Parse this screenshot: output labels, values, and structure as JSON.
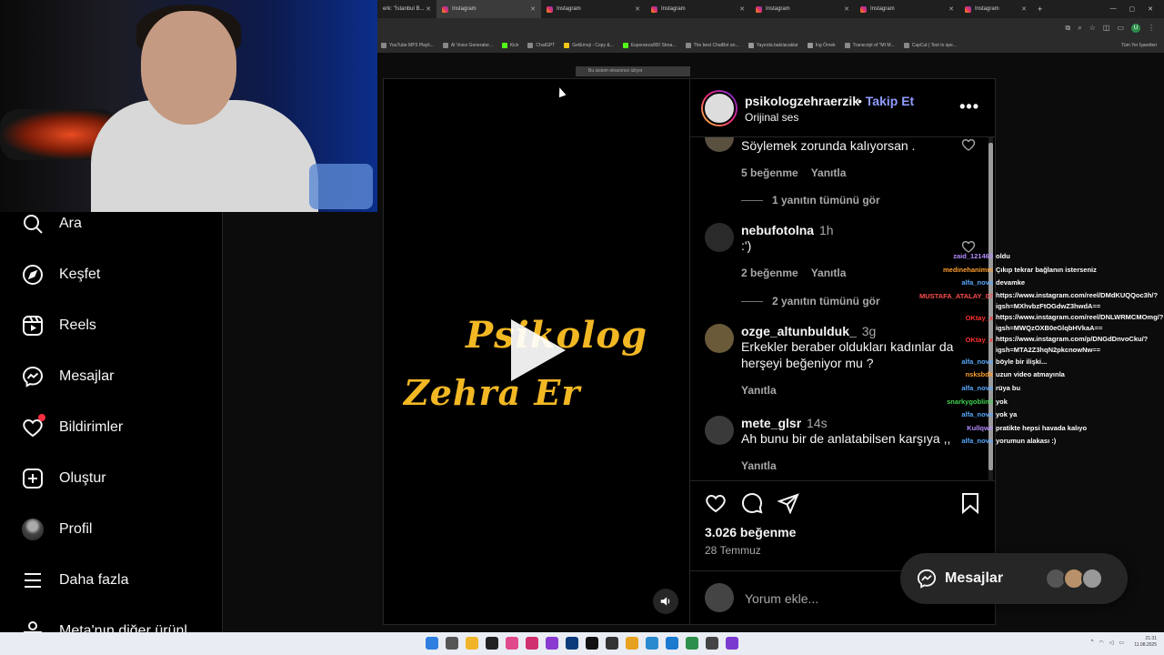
{
  "browser": {
    "tabs": [
      {
        "label": "erk: \"İstanbul B..."
      },
      {
        "label": "Instagram",
        "active": true
      },
      {
        "label": "Instagram"
      },
      {
        "label": "Instagram"
      },
      {
        "label": "Instagram"
      },
      {
        "label": "Instagram"
      },
      {
        "label": "Instagram"
      }
    ],
    "bookmarks": [
      "YouTube MP3 Playli...",
      "AI Voice Generator...",
      "Kick",
      "ChatGPT",
      "GetEmoji - Copy &...",
      "Esperanza000 Strea...",
      "The best ChatBot an...",
      "Yayında bakılacaklar",
      "İng Örnek",
      "Transcript of \"MI M...",
      "CapCut | Text to spe..."
    ],
    "bookmarks_all": "Tüm Yer İşaretleri",
    "profile_initial": "U",
    "banner": "Bu sistem ekranınızı izliyor"
  },
  "sidebar": {
    "items": [
      {
        "label": "Ara",
        "icon": "search-icon"
      },
      {
        "label": "Keşfet",
        "icon": "compass-icon"
      },
      {
        "label": "Reels",
        "icon": "reels-icon"
      },
      {
        "label": "Mesajlar",
        "icon": "messenger-icon"
      },
      {
        "label": "Bildirimler",
        "icon": "heart-icon"
      },
      {
        "label": "Oluştur",
        "icon": "plus-square-icon"
      },
      {
        "label": "Profil",
        "icon": "avatar"
      },
      {
        "label": "Daha fazla",
        "icon": "menu-icon"
      },
      {
        "label": "Meta'nın diğer ürünl",
        "icon": "meta-apps-icon"
      }
    ]
  },
  "video": {
    "title_line1": "Psikolog",
    "title_line2": "Zehra Er"
  },
  "post": {
    "username": "psikologzehraerzik",
    "follow": "Takip Et",
    "separator": "•",
    "audio": "Orijinal ses",
    "likes": "3.026 beğenme",
    "date": "28 Temmuz",
    "comment_placeholder": "Yorum ekle...",
    "comments": [
      {
        "user": "",
        "time": "",
        "text": "Söylemek zorunda kalıyorsan .",
        "likes": "5 beğenme",
        "reply": "Yanıtla",
        "replies": "1 yanıtın tümünü gör"
      },
      {
        "user": "nebufotolna",
        "time": "1h",
        "text": ":')",
        "likes": "2 beğenme",
        "reply": "Yanıtla",
        "replies": "2 yanıtın tümünü gör"
      },
      {
        "user": "ozge_altunbulduk_",
        "time": "3g",
        "text": "Erkekler beraber oldukları kadınlar da herşeyi beğeniyor mu ?",
        "likes": "",
        "reply": "Yanıtla",
        "replies": ""
      },
      {
        "user": "mete_glsr",
        "time": "14s",
        "text": "Ah bunu bir de anlatabilsen karşıya ,,",
        "likes": "",
        "reply": "Yanıtla",
        "replies": ""
      }
    ]
  },
  "chat": [
    {
      "name": "zaid_121463",
      "color": "#b48cff",
      "text": "oldu"
    },
    {
      "name": "medinehanimm",
      "color": "#ff9f2e",
      "text": "Çıkıp tekrar bağlanın isterseniz"
    },
    {
      "name": "alfa_nova",
      "color": "#5aa8ff",
      "text": "devamke"
    },
    {
      "name": "MUSTAFA_ATALAY_07",
      "color": "#ff4d4d",
      "text": "https://www.instagram.com/reel/DMdKUQQoc3h/?igsh=MXhvbzFtOGdwZ3hwdA=="
    },
    {
      "name": "OKtay_x",
      "color": "#ff3030",
      "text": "https://www.instagram.com/reel/DNLWRMCMOmg/?igsh=MWQzOXB0eGlqbHVkaA=="
    },
    {
      "name": "OKtay_x",
      "color": "#ff3030",
      "text": "https://www.instagram.com/p/DNGdDnvoCku/?igsh=MTA2Z3hqN2pkcnowNw=="
    },
    {
      "name": "alfa_nova",
      "color": "#5aa8ff",
      "text": "böyle bir ilişki..."
    },
    {
      "name": "nsksbdk",
      "color": "#ff9f2e",
      "text": "uzun video atmayınla"
    },
    {
      "name": "alfa_nova",
      "color": "#5aa8ff",
      "text": "rüya bu"
    },
    {
      "name": "snarkygoblin0",
      "color": "#3fd34f",
      "text": "yok"
    },
    {
      "name": "alfa_nova",
      "color": "#5aa8ff",
      "text": "yok ya"
    },
    {
      "name": "Kullqwe",
      "color": "#b48cff",
      "text": "pratikte hepsi havada kalıyo"
    },
    {
      "name": "alfa_nova",
      "color": "#5aa8ff",
      "text": "yorumun alakası :)"
    }
  ],
  "messages_button": {
    "label": "Mesajlar"
  },
  "taskbar": {
    "time": "21:31",
    "date": "11.08.2025"
  }
}
